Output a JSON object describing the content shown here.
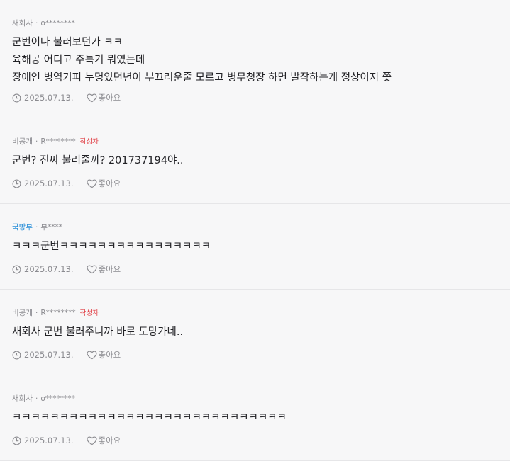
{
  "comments": [
    {
      "company": "새회사",
      "company_highlight": false,
      "user": "o********",
      "author_badge": "",
      "lines": [
        "군번이나 불러보던가 ㅋㅋ",
        "육해공 어디고 주특기 뭐였는데",
        "장애인 병역기피 누명있던년이 부끄러운줄 모르고 병무청장 하면 발작하는게 정상이지 쯧"
      ],
      "date": "2025.07.13.",
      "like_label": "좋아요"
    },
    {
      "company": "비공개",
      "company_highlight": false,
      "user": "R********",
      "author_badge": "작성자",
      "lines": [
        "군번? 진짜 불러줄까? 201737194야.."
      ],
      "date": "2025.07.13.",
      "like_label": "좋아요"
    },
    {
      "company": "국방부",
      "company_highlight": true,
      "user": "부****",
      "author_badge": "",
      "lines": [
        "ㅋㅋㅋ군번ㅋㅋㅋㅋㅋㅋㅋㅋㅋㅋㅋㅋㅋㅋㅋㅋ"
      ],
      "date": "2025.07.13.",
      "like_label": "좋아요"
    },
    {
      "company": "비공개",
      "company_highlight": false,
      "user": "R********",
      "author_badge": "작성자",
      "lines": [
        "새회사 군번 불러주니까 바로 도망가네.."
      ],
      "date": "2025.07.13.",
      "like_label": "좋아요"
    },
    {
      "company": "새회사",
      "company_highlight": false,
      "user": "o********",
      "author_badge": "",
      "lines": [
        "ㅋㅋㅋㅋㅋㅋㅋㅋㅋㅋㅋㅋㅋㅋㅋㅋㅋㅋㅋㅋㅋㅋㅋㅋㅋㅋㅋㅋㅋ"
      ],
      "date": "2025.07.13.",
      "like_label": "좋아요"
    }
  ],
  "colors": {
    "background": "#f7f7f8",
    "text": "#222226",
    "meta": "#8b8b90",
    "company_highlight": "#2a8fd8",
    "author_badge": "#e0383e",
    "divider": "#e6e6e8"
  },
  "icons": {
    "time": "clock-icon",
    "like": "heart-icon"
  }
}
